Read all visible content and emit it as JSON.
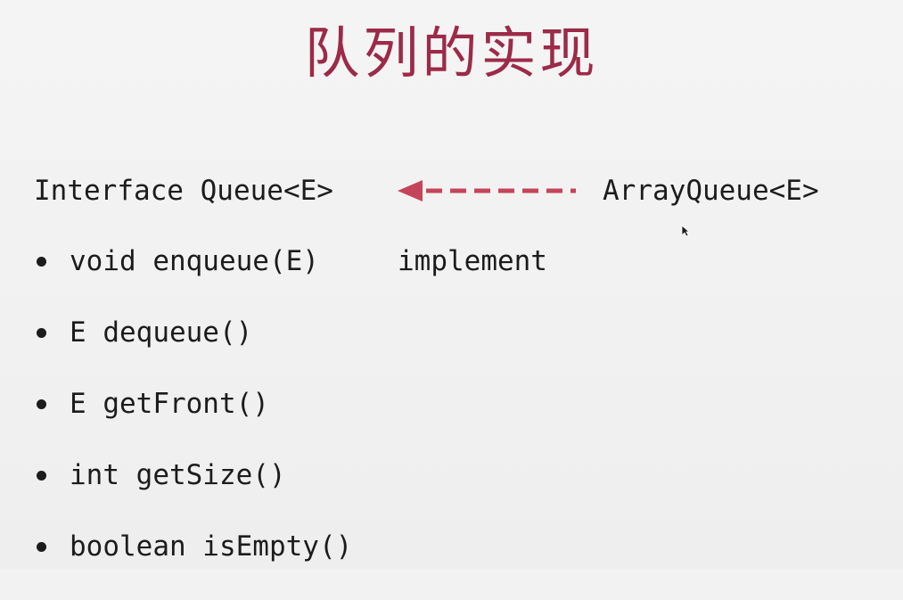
{
  "slide": {
    "title": "队列的实现",
    "interface_decl": "Interface Queue<E>",
    "impl_class": "ArrayQueue<E>",
    "relation_label": "implement",
    "methods": [
      "void enqueue(E)",
      "E dequeue()",
      "E getFront()",
      "int getSize()",
      "boolean isEmpty()"
    ]
  },
  "colors": {
    "title": "#9c2a48",
    "arrow": "#c4455a",
    "text": "#1c1c1c",
    "background": "#f2f2f2"
  },
  "icons": {
    "arrow": "dashed-left-arrow-icon",
    "cursor": "mouse-pointer-icon"
  }
}
